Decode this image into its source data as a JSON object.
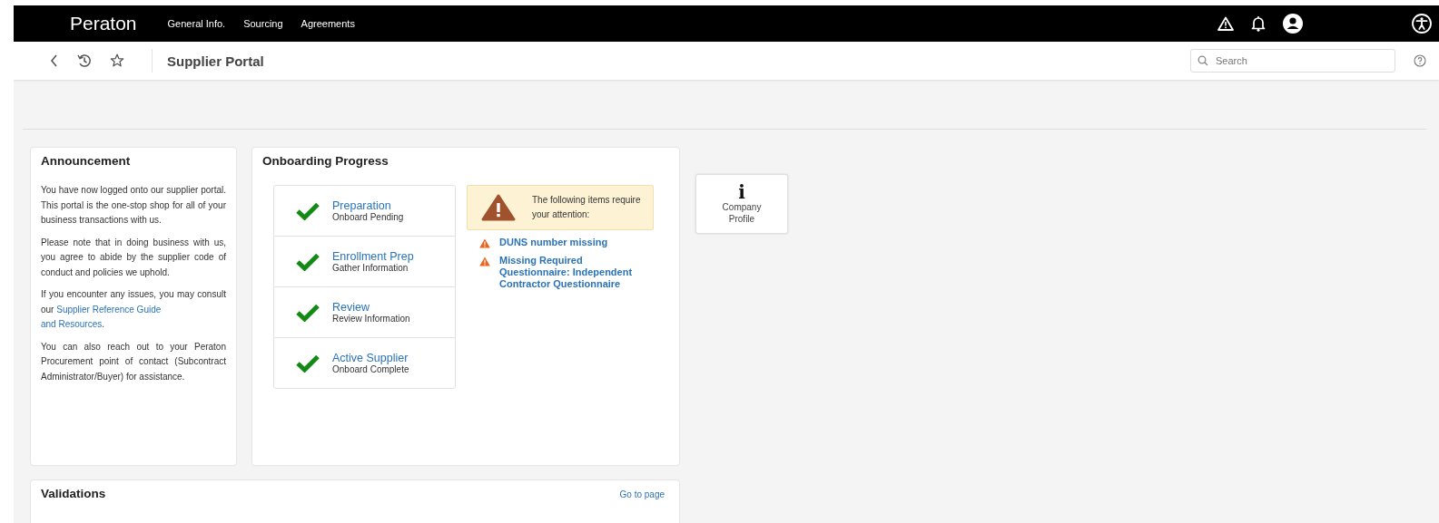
{
  "header": {
    "logo": "Peraton",
    "nav": [
      {
        "label": "General Info."
      },
      {
        "label": "Sourcing"
      },
      {
        "label": "Agreements"
      }
    ]
  },
  "toolbar": {
    "title": "Supplier Portal",
    "search": {
      "placeholder": "Search"
    }
  },
  "announcement": {
    "title": "Announcement",
    "paragraphs": [
      {
        "text": "You have now logged onto our supplier portal. This portal is the one-stop shop for all of your business transactions with us."
      },
      {
        "text": "Please note that in doing business with us, you agree to abide by the supplier code of conduct and policies we uphold."
      },
      {
        "text": "If you encounter any issues, you may consult our ",
        "link": [
          "Supplier Reference Guide",
          "and Resources"
        ],
        "after": "."
      },
      {
        "text": "You can also reach out to your Peraton Procurement point of contact (Subcontract Administrator/Buyer) for assistance."
      }
    ]
  },
  "onboarding": {
    "title": "Onboarding Progress",
    "steps": [
      {
        "name": "Preparation",
        "status": "Onboard Pending",
        "complete": true
      },
      {
        "name": "Enrollment Prep",
        "status": "Gather Information",
        "complete": true
      },
      {
        "name": "Review",
        "status": "Review Information",
        "complete": true
      },
      {
        "name": "Active Supplier",
        "status": "Onboard Complete",
        "complete": true
      }
    ],
    "alert": "The following items require your attention:",
    "issues": [
      "DUNS number missing",
      "Missing Required Questionnaire: Independent Contractor Questionnaire"
    ]
  },
  "tile": {
    "icon": "i",
    "label": "Company Profile"
  },
  "validations": {
    "title": "Validations",
    "link": "Go to page"
  }
}
